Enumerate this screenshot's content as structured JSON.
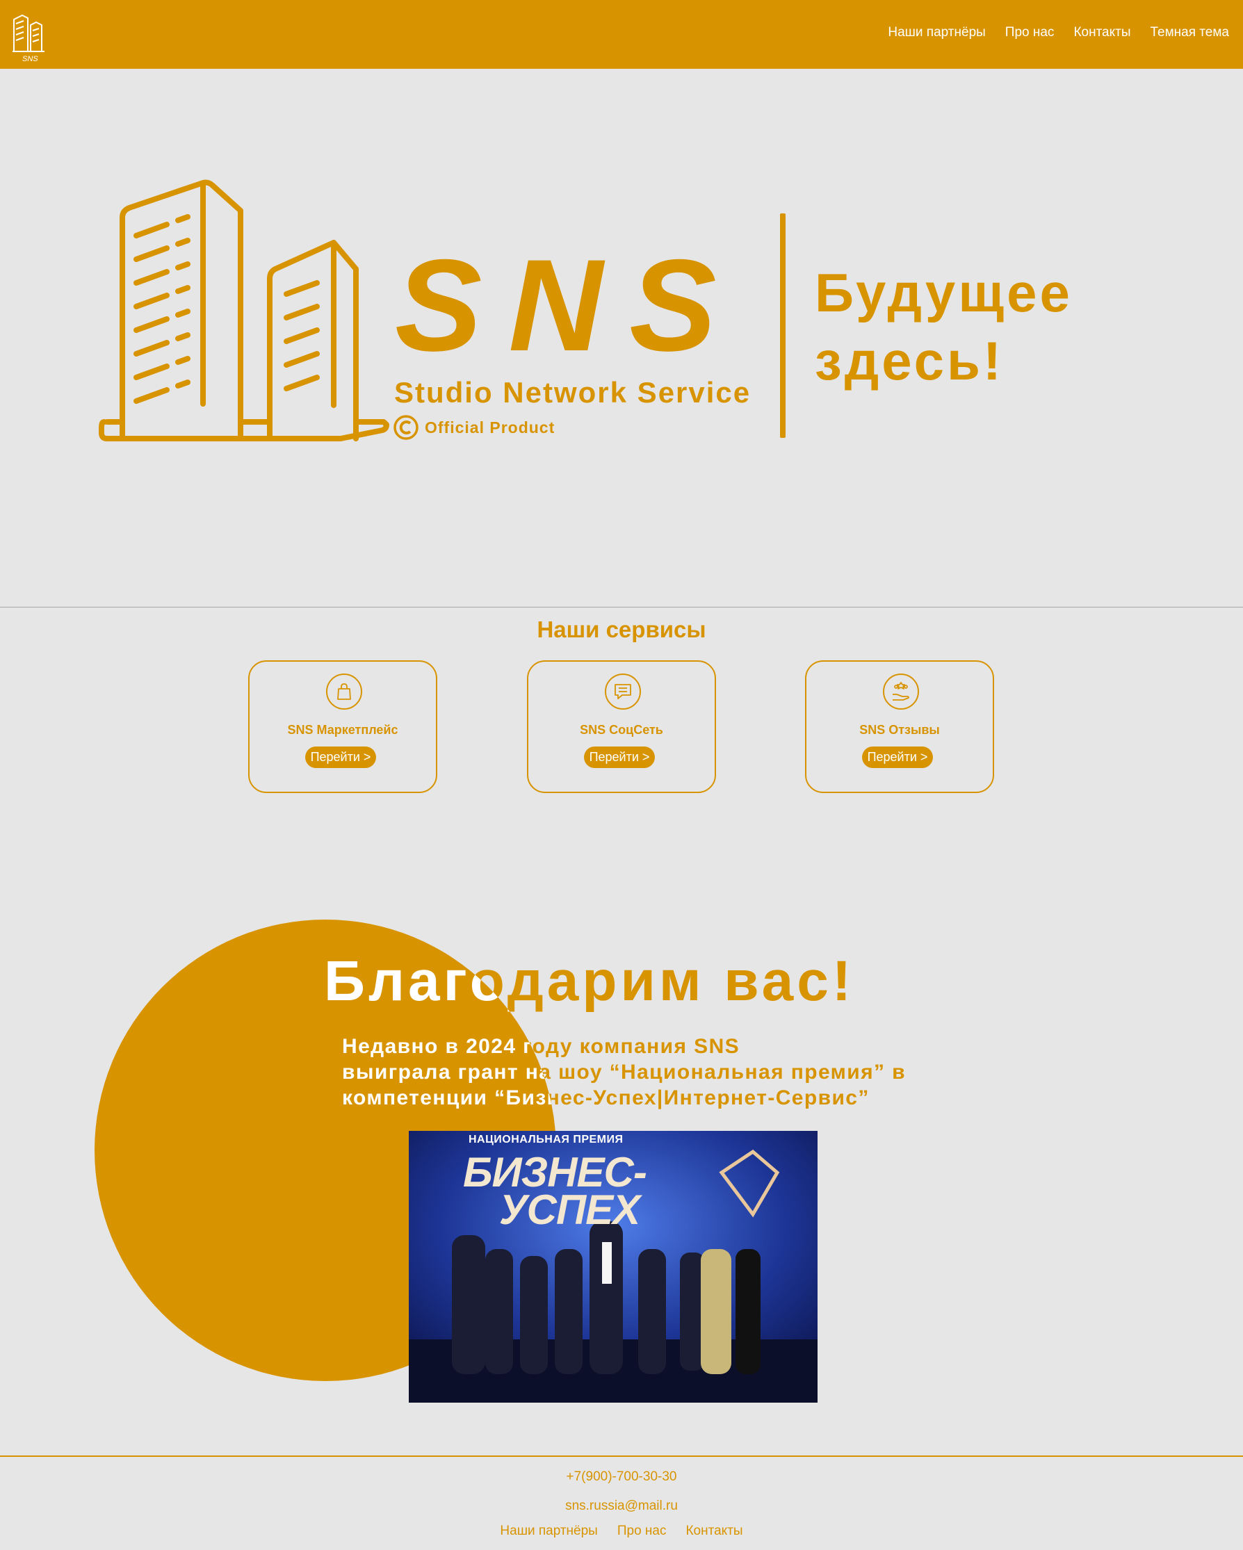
{
  "header": {
    "logo_text": "SNS",
    "nav": [
      "Наши партнёры",
      "Про нас",
      "Контакты",
      "Темная тема"
    ]
  },
  "hero": {
    "brand": "SNS",
    "subtitle": "Studio Network Service",
    "official": "Official Product",
    "tagline_line1": "Будущее",
    "tagline_line2": "здесь!"
  },
  "services": {
    "title": "Наши сервисы",
    "cards": [
      {
        "title": "SNS Маркетплейс",
        "button": "Перейти >",
        "icon": "shopping-bag-icon"
      },
      {
        "title": "SNS СоцСеть",
        "button": "Перейти >",
        "icon": "chat-icon"
      },
      {
        "title": "SNS Отзывы",
        "button": "Перейти >",
        "icon": "review-hand-icon"
      }
    ]
  },
  "thanks": {
    "title": "Благодарим вас!",
    "line1": "Недавно в 2024 году компания SNS",
    "line2": "выиграла грант на шоу “Национальная премия” в",
    "line3": "компетенции “Бизнес-Успех|Интернет-Сервис”",
    "photo_label": "НАЦИОНАЛЬНАЯ ПРЕМИЯ",
    "photo_big1": "БИЗНЕС-",
    "photo_big2": "УСПЕХ"
  },
  "footer": {
    "phone": "+7(900)-700-30-30",
    "email": "sns.russia@mail.ru",
    "nav": [
      "Наши партнёры",
      "Про нас",
      "Контакты"
    ]
  },
  "colors": {
    "accent": "#d89400",
    "background": "#e6e6e6",
    "text_on_accent": "#ffffff"
  }
}
